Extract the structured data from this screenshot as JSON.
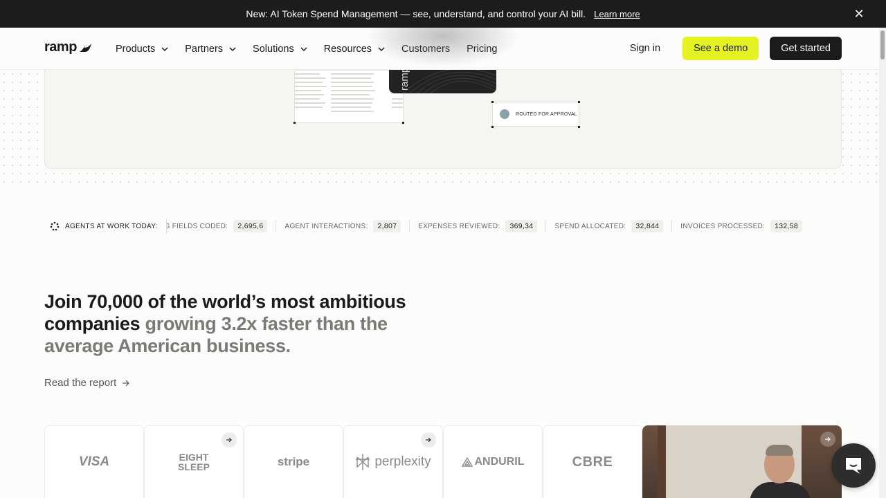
{
  "announcement": {
    "text": "New: AI Token Spend Management — see, understand, and control your AI bill.",
    "link": "Learn more"
  },
  "header": {
    "logo": "ramp",
    "nav": [
      {
        "label": "Products",
        "dropdown": true
      },
      {
        "label": "Partners",
        "dropdown": true
      },
      {
        "label": "Solutions",
        "dropdown": true
      },
      {
        "label": "Resources",
        "dropdown": true
      },
      {
        "label": "Customers",
        "dropdown": false
      },
      {
        "label": "Pricing",
        "dropdown": false
      }
    ],
    "sign_in": "Sign in",
    "see_demo": "See a demo",
    "get_started": "Get started"
  },
  "hero": {
    "card_brand": "ramp",
    "approval_label": "ROUTED FOR APPROVAL"
  },
  "ticker": {
    "label": "AGENTS AT WORK TODAY:",
    "metrics": [
      {
        "label": "ING FIELDS CODED:",
        "value": "2,695,6"
      },
      {
        "label": "AGENT INTERACTIONS:",
        "value": "2,807"
      },
      {
        "label": "EXPENSES REVIEWED:",
        "value": "369,34"
      },
      {
        "label": "SPEND ALLOCATED:",
        "value": "32,844"
      },
      {
        "label": "INVOICES PROCESSED:",
        "value": "132,58"
      }
    ]
  },
  "headline": {
    "dark": "Join 70,000 of the world’s most ambitious companies",
    "muted": " growing 3.2x faster than the average American business."
  },
  "report_link": "Read the report",
  "logos": [
    {
      "name": "VISA",
      "arrow": false
    },
    {
      "name": "EIGHT SLEEP",
      "arrow": true
    },
    {
      "name": "stripe",
      "arrow": false
    },
    {
      "name": "perplexity",
      "arrow": true
    },
    {
      "name": "ANDURIL",
      "arrow": false
    },
    {
      "name": "CBRE",
      "arrow": false
    }
  ],
  "colors": {
    "accent": "#e4f222",
    "dark": "#1c1c1c",
    "background": "#fcfcfa"
  }
}
